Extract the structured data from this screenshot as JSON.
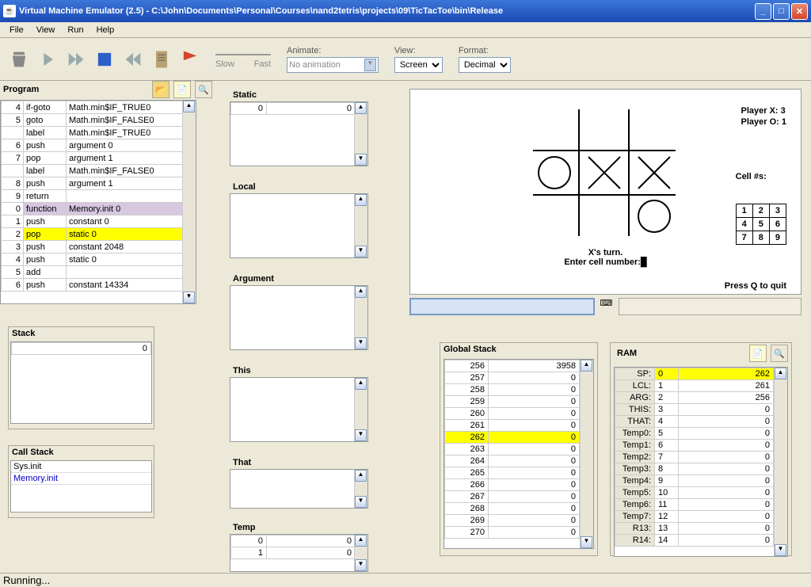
{
  "window": {
    "title": "Virtual Machine Emulator (2.5) - C:\\John\\Documents\\Personal\\Courses\\nand2tetris\\projects\\09\\TicTacToe\\bin\\Release"
  },
  "menu": [
    "File",
    "View",
    "Run",
    "Help"
  ],
  "toolbar": {
    "slider": {
      "slow": "Slow",
      "fast": "Fast"
    },
    "animate": {
      "label": "Animate:",
      "value": "No animation"
    },
    "view": {
      "label": "View:",
      "value": "Screen"
    },
    "format": {
      "label": "Format:",
      "value": "Decimal"
    }
  },
  "program": {
    "title": "Program",
    "rows": [
      {
        "n": "4",
        "op": "if-goto",
        "arg": "Math.min$IF_TRUE0"
      },
      {
        "n": "5",
        "op": "goto",
        "arg": "Math.min$IF_FALSE0"
      },
      {
        "n": "",
        "op": "label",
        "arg": "Math.min$IF_TRUE0"
      },
      {
        "n": "6",
        "op": "push",
        "arg": "argument 0"
      },
      {
        "n": "7",
        "op": "pop",
        "arg": "argument 1"
      },
      {
        "n": "",
        "op": "label",
        "arg": "Math.min$IF_FALSE0"
      },
      {
        "n": "8",
        "op": "push",
        "arg": "argument 1"
      },
      {
        "n": "9",
        "op": "return",
        "arg": ""
      },
      {
        "n": "0",
        "op": "function",
        "arg": "Memory.init 0",
        "hl": "purple"
      },
      {
        "n": "1",
        "op": "push",
        "arg": "constant 0"
      },
      {
        "n": "2",
        "op": "pop",
        "arg": "static 0",
        "hl": "yellow"
      },
      {
        "n": "3",
        "op": "push",
        "arg": "constant 2048"
      },
      {
        "n": "4",
        "op": "push",
        "arg": "static 0"
      },
      {
        "n": "5",
        "op": "add",
        "arg": ""
      },
      {
        "n": "6",
        "op": "push",
        "arg": "constant 14334"
      }
    ]
  },
  "stack": {
    "title": "Stack",
    "rows": [
      {
        "v": "0"
      }
    ]
  },
  "callstack": {
    "title": "Call Stack",
    "items": [
      "Sys.init",
      "Memory.init"
    ]
  },
  "segments": {
    "static": {
      "title": "Static",
      "rows": [
        {
          "a": "0",
          "v": "0"
        }
      ]
    },
    "local": {
      "title": "Local",
      "rows": []
    },
    "argument": {
      "title": "Argument",
      "rows": []
    },
    "this": {
      "title": "This",
      "rows": []
    },
    "that": {
      "title": "That",
      "rows": []
    },
    "temp": {
      "title": "Temp",
      "rows": [
        {
          "a": "0",
          "v": "0"
        },
        {
          "a": "1",
          "v": "0"
        }
      ]
    }
  },
  "screen": {
    "score": "Player X: 3\nPlayer O: 1",
    "cells_label": "Cell #s:",
    "grid": [
      [
        "1",
        "2",
        "3"
      ],
      [
        "4",
        "5",
        "6"
      ],
      [
        "7",
        "8",
        "9"
      ]
    ],
    "turn": "X's turn.\nEnter cell number:█",
    "quit": "Press Q to quit"
  },
  "globalstack": {
    "title": "Global Stack",
    "rows": [
      {
        "a": "256",
        "v": "3958"
      },
      {
        "a": "257",
        "v": "0"
      },
      {
        "a": "258",
        "v": "0"
      },
      {
        "a": "259",
        "v": "0"
      },
      {
        "a": "260",
        "v": "0"
      },
      {
        "a": "261",
        "v": "0"
      },
      {
        "a": "262",
        "v": "0",
        "hl": "yellow"
      },
      {
        "a": "263",
        "v": "0"
      },
      {
        "a": "264",
        "v": "0"
      },
      {
        "a": "265",
        "v": "0"
      },
      {
        "a": "266",
        "v": "0"
      },
      {
        "a": "267",
        "v": "0"
      },
      {
        "a": "268",
        "v": "0"
      },
      {
        "a": "269",
        "v": "0"
      },
      {
        "a": "270",
        "v": "0"
      }
    ]
  },
  "ram": {
    "title": "RAM",
    "rows": [
      {
        "name": "SP:",
        "a": "0",
        "v": "262",
        "hl": "yellow"
      },
      {
        "name": "LCL:",
        "a": "1",
        "v": "261"
      },
      {
        "name": "ARG:",
        "a": "2",
        "v": "256"
      },
      {
        "name": "THIS:",
        "a": "3",
        "v": "0"
      },
      {
        "name": "THAT:",
        "a": "4",
        "v": "0"
      },
      {
        "name": "Temp0:",
        "a": "5",
        "v": "0"
      },
      {
        "name": "Temp1:",
        "a": "6",
        "v": "0"
      },
      {
        "name": "Temp2:",
        "a": "7",
        "v": "0"
      },
      {
        "name": "Temp3:",
        "a": "8",
        "v": "0"
      },
      {
        "name": "Temp4:",
        "a": "9",
        "v": "0"
      },
      {
        "name": "Temp5:",
        "a": "10",
        "v": "0"
      },
      {
        "name": "Temp6:",
        "a": "11",
        "v": "0"
      },
      {
        "name": "Temp7:",
        "a": "12",
        "v": "0"
      },
      {
        "name": "R13:",
        "a": "13",
        "v": "0"
      },
      {
        "name": "R14:",
        "a": "14",
        "v": "0"
      }
    ]
  },
  "status": "Running..."
}
